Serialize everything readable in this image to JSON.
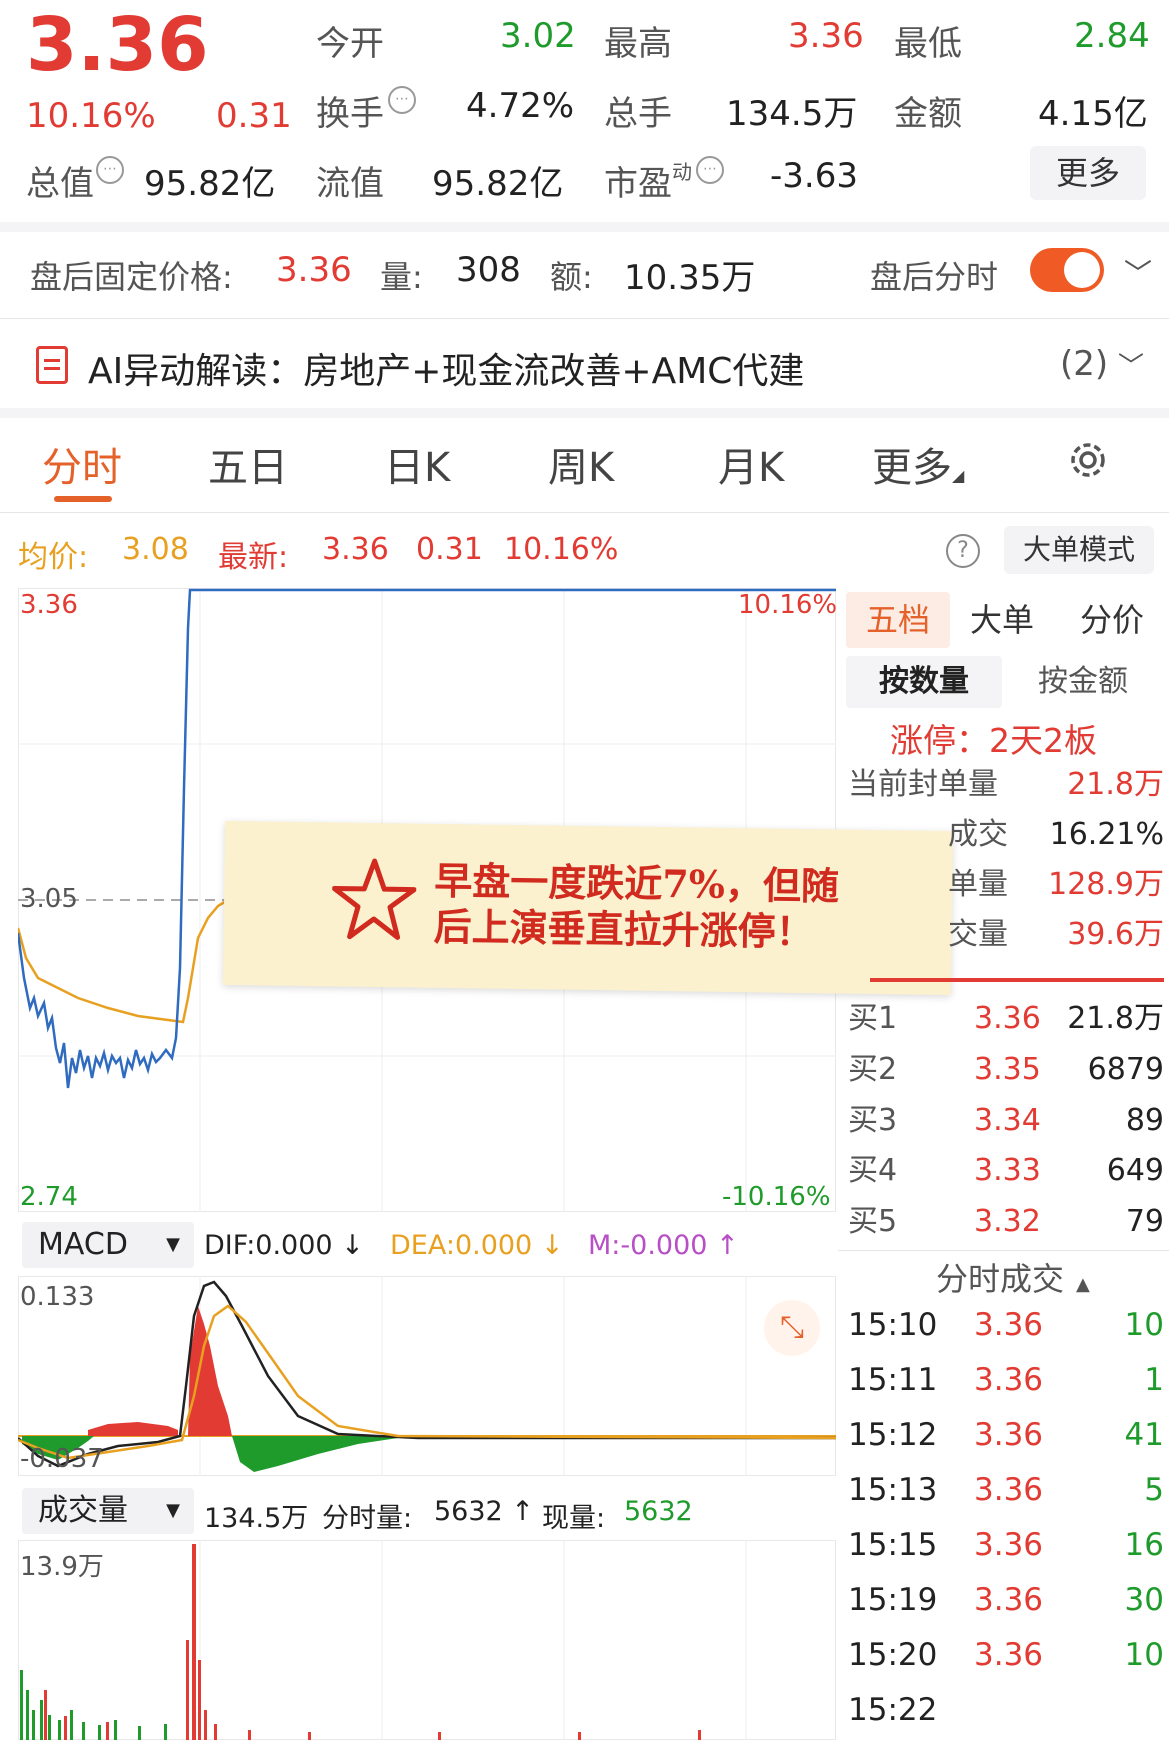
{
  "quote": {
    "price": "3.36",
    "change_pct": "10.16%",
    "change": "0.31",
    "stats": [
      {
        "label": "今开",
        "value": "3.02"
      },
      {
        "label": "最高",
        "value": "3.36"
      },
      {
        "label": "最低",
        "value": "2.84"
      },
      {
        "label": "换手",
        "value": "4.72%"
      },
      {
        "label": "总手",
        "value": "134.5万"
      },
      {
        "label": "金额",
        "value": "4.15亿"
      },
      {
        "label": "总值",
        "value": "95.82亿"
      },
      {
        "label": "流值",
        "value": "95.82亿"
      },
      {
        "label": "市盈",
        "sup": "动",
        "value": "-3.63"
      }
    ],
    "more_button": "更多"
  },
  "after_hours": {
    "label": "盘后固定价格:",
    "price": "3.36",
    "vol_label": "量:",
    "vol": "308",
    "amt_label": "额:",
    "amt": "10.35万",
    "toggle_label": "盘后分时",
    "toggle_on": true
  },
  "ai_bar": {
    "text": "AI异动解读：房地产+现金流改善+AMC代建",
    "count": "(2)"
  },
  "tabs": [
    "分时",
    "五日",
    "日K",
    "周K",
    "月K",
    "更多"
  ],
  "active_tab": 0,
  "intraday_header": {
    "avg_label": "均价:",
    "avg": "3.08",
    "latest_label": "最新:",
    "latest": "3.36",
    "chg": "0.31",
    "pct": "10.16%",
    "mode_button": "大单模式"
  },
  "price_axis": {
    "top": "3.36",
    "mid": "3.05",
    "bottom": "2.74",
    "top_pct": "10.16%",
    "bottom_pct": "-10.16%"
  },
  "macd": {
    "selector": "MACD",
    "dif": "DIF:0.000 ↓",
    "dea": "DEA:0.000 ↓",
    "m": "M:-0.000 ↑",
    "top": "0.133",
    "bottom": "-0.037"
  },
  "volume": {
    "selector": "成交量",
    "total": "134.5万",
    "period_label": "分时量:",
    "period": "5632 ↑",
    "current_label": "现量:",
    "current": "5632",
    "axis_top": "13.9万"
  },
  "annotation": {
    "text": "早盘一度跌近7%，但随\n后上演垂直拉升涨停！"
  },
  "order_book": {
    "tabs": [
      "五档",
      "大单",
      "分价"
    ],
    "subtabs": [
      "按数量",
      "按金额"
    ],
    "limit_status": "涨停：2天2板",
    "stats": [
      {
        "label": "当前封单量",
        "value": "21.8万"
      },
      {
        "label": "成交",
        "value": "16.21%"
      },
      {
        "label": "单量",
        "value": "128.9万"
      },
      {
        "label": "交量",
        "value": "39.6万"
      }
    ],
    "bids": [
      {
        "label": "买1",
        "price": "3.36",
        "vol": "21.8万"
      },
      {
        "label": "买2",
        "price": "3.35",
        "vol": "6879"
      },
      {
        "label": "买3",
        "price": "3.34",
        "vol": "89"
      },
      {
        "label": "买4",
        "price": "3.33",
        "vol": "649"
      },
      {
        "label": "买5",
        "price": "3.32",
        "vol": "79"
      }
    ]
  },
  "ticks": {
    "header": "分时成交",
    "rows": [
      {
        "time": "15:10",
        "price": "3.36",
        "vol": "10"
      },
      {
        "time": "15:11",
        "price": "3.36",
        "vol": "1"
      },
      {
        "time": "15:12",
        "price": "3.36",
        "vol": "41"
      },
      {
        "time": "15:13",
        "price": "3.36",
        "vol": "5"
      },
      {
        "time": "15:15",
        "price": "3.36",
        "vol": "16"
      },
      {
        "time": "15:19",
        "price": "3.36",
        "vol": "30"
      },
      {
        "time": "15:20",
        "price": "3.36",
        "vol": "10"
      },
      {
        "time": "15:22",
        "price": "",
        "vol": ""
      }
    ]
  },
  "colors": {
    "up": "#e13b33",
    "down": "#1f9b2c",
    "accent": "#e4622a",
    "price_line": "#2f6bbf",
    "avg_line": "#e8a020"
  }
}
